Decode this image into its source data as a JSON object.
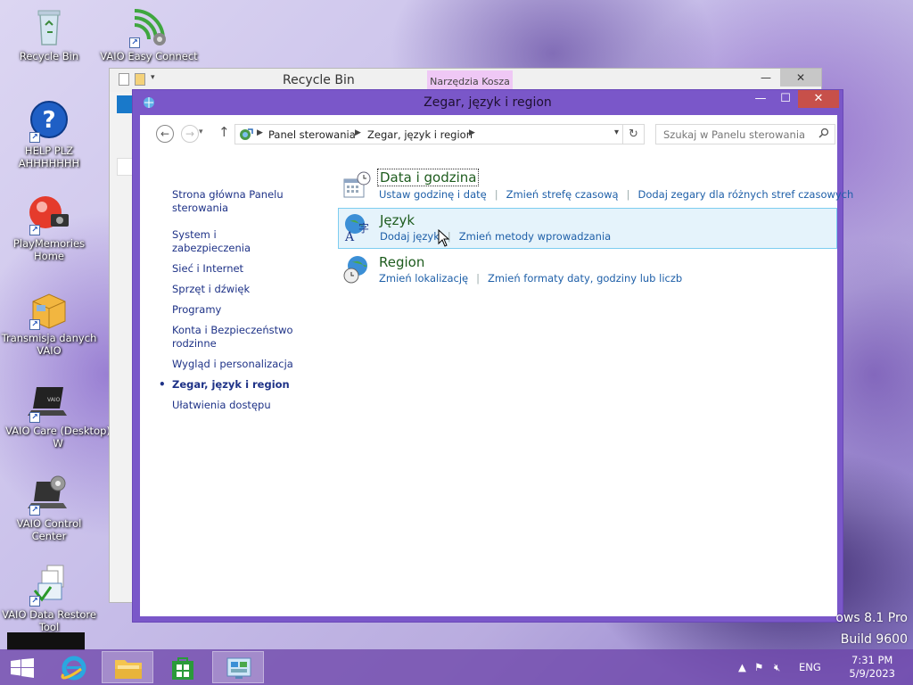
{
  "desktop": {
    "icons": [
      {
        "label": "Recycle Bin"
      },
      {
        "label": "VAIO Easy Connect"
      },
      {
        "label": "HELP PLZ AHHHHHHH"
      },
      {
        "label": "PlayMemories Home"
      },
      {
        "label": "Transmisja danych VAIO"
      },
      {
        "label": "VAIO Care (Desktop) W"
      },
      {
        "label": "VAIO Control Center"
      },
      {
        "label": "VAIO Data Restore Tool"
      }
    ],
    "watermark_line1": "ows 8.1 Pro",
    "watermark_line2": "Build 9600"
  },
  "back_window": {
    "title": "Recycle Bin",
    "ribbon_tab": "Narzędzia Kosza",
    "minimize": "—",
    "close": "✕"
  },
  "window": {
    "title": "Zegar, język i region",
    "minimize": "—",
    "maximize": "☐",
    "close": "✕",
    "breadcrumb": [
      "Panel sterowania",
      "Zegar, język i region"
    ],
    "search_placeholder": "Szukaj w Panelu sterowania",
    "left_nav": {
      "home": "Strona główna Panelu sterowania",
      "items": [
        "System i zabezpieczenia",
        "Sieć i Internet",
        "Sprzęt i dźwięk",
        "Programy",
        "Konta i Bezpieczeństwo rodzinne",
        "Wygląd i personalizacja",
        "Zegar, język i region",
        "Ułatwienia dostępu"
      ],
      "active_index": 6
    },
    "categories": [
      {
        "title": "Data i godzina",
        "links": [
          "Ustaw godzinę i datę",
          "Zmień strefę czasową",
          "Dodaj zegary dla różnych stref czasowych"
        ]
      },
      {
        "title": "Język",
        "links": [
          "Dodaj język",
          "Zmień metody wprowadzania"
        ]
      },
      {
        "title": "Region",
        "links": [
          "Zmień lokalizację",
          "Zmień formaty daty, godziny lub liczb"
        ]
      }
    ]
  },
  "taskbar": {
    "language": "ENG",
    "time": "7:31 PM",
    "date": "5/9/2023"
  },
  "colors": {
    "window_frame": "#7a57c9",
    "link": "#1e3287",
    "category_title": "#1e5c1e",
    "hover_bg": "#e5f3fb",
    "hover_border": "#7dcdf0"
  }
}
